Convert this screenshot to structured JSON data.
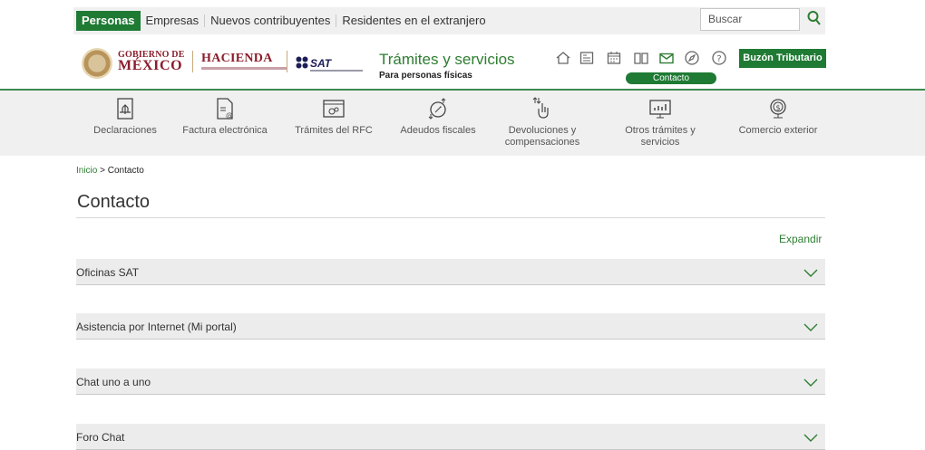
{
  "topbar": {
    "tabs": [
      "Personas",
      "Empresas",
      "Nuevos contribuyentes",
      "Residentes en el extranjero"
    ],
    "active_tab": "Personas",
    "search_placeholder": "Buscar",
    "search_icon": "search-icon"
  },
  "header": {
    "gob_small": "GOBIERNO DE",
    "gob_big": "MÉXICO",
    "hacienda": "HACIENDA",
    "sat": "SAT",
    "section_title": "Trámites y servicios",
    "section_subtitle": "Para personas físicas",
    "icons": [
      "home-icon",
      "newspaper-icon",
      "calendar-icon",
      "book-icon",
      "mail-icon",
      "compass-icon",
      "help-icon"
    ],
    "active_icon_label": "Contacto",
    "buzon_label": "Buzón Tributario",
    "brand_color": "#1f7a34",
    "gob_color": "#8a1d2c"
  },
  "nav": {
    "items": [
      {
        "label": "Declaraciones",
        "icon": "declarations-icon"
      },
      {
        "label": "Factura electrónica",
        "icon": "invoice-icon"
      },
      {
        "label": "Trámites del RFC",
        "icon": "rfc-icon"
      },
      {
        "label": "Adeudos fiscales",
        "icon": "debts-icon"
      },
      {
        "label": "Devoluciones y compensaciones",
        "icon": "refunds-icon"
      },
      {
        "label": "Otros trámites y servicios",
        "icon": "other-services-icon"
      },
      {
        "label": "Comercio exterior",
        "icon": "foreign-trade-icon"
      }
    ]
  },
  "breadcrumb": {
    "home": "Inicio",
    "separator": " > ",
    "current": "Contacto"
  },
  "page": {
    "title": "Contacto",
    "expand_label": "Expandir"
  },
  "accordion": {
    "items": [
      "Oficinas SAT",
      "Asistencia por Internet (Mi portal)",
      "Chat uno a uno",
      "Foro Chat"
    ]
  }
}
